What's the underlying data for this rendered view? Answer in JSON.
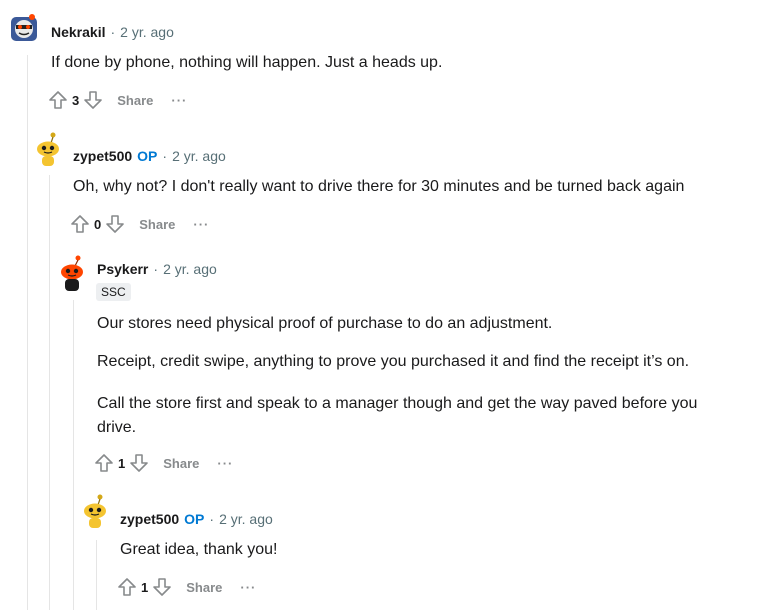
{
  "comments": [
    {
      "author": "Nekrakil",
      "op": "",
      "time": "2 yr. ago",
      "flair": "",
      "body": [
        "If done by phone, nothing will happen. Just a heads up."
      ],
      "score": "3",
      "share": "Share",
      "more": "···"
    },
    {
      "author": "zypet500",
      "op": "OP",
      "time": "2 yr. ago",
      "flair": "",
      "body": [
        "Oh, why not? I don't really want to drive there for 30 minutes and be turned back again"
      ],
      "score": "0",
      "share": "Share",
      "more": "···"
    },
    {
      "author": "Psykerr",
      "op": "",
      "time": "2 yr. ago",
      "flair": "SSC",
      "body": [
        "Our stores need physical proof of purchase to do an adjustment.",
        "Receipt, credit swipe, anything to prove you purchased it and find the receipt it’s on.",
        "Call the store first and speak to a manager though and get the way paved before you",
        "drive."
      ],
      "score": "1",
      "share": "Share",
      "more": "···"
    },
    {
      "author": "zypet500",
      "op": "OP",
      "time": "2 yr. ago",
      "flair": "",
      "body": [
        "Great idea, thank you!"
      ],
      "score": "1",
      "share": "Share",
      "more": "···"
    }
  ],
  "separator": "·",
  "colors": {
    "op": "#0079d3",
    "muted": "#878a8c",
    "thread_line": "#e5e5e5"
  }
}
